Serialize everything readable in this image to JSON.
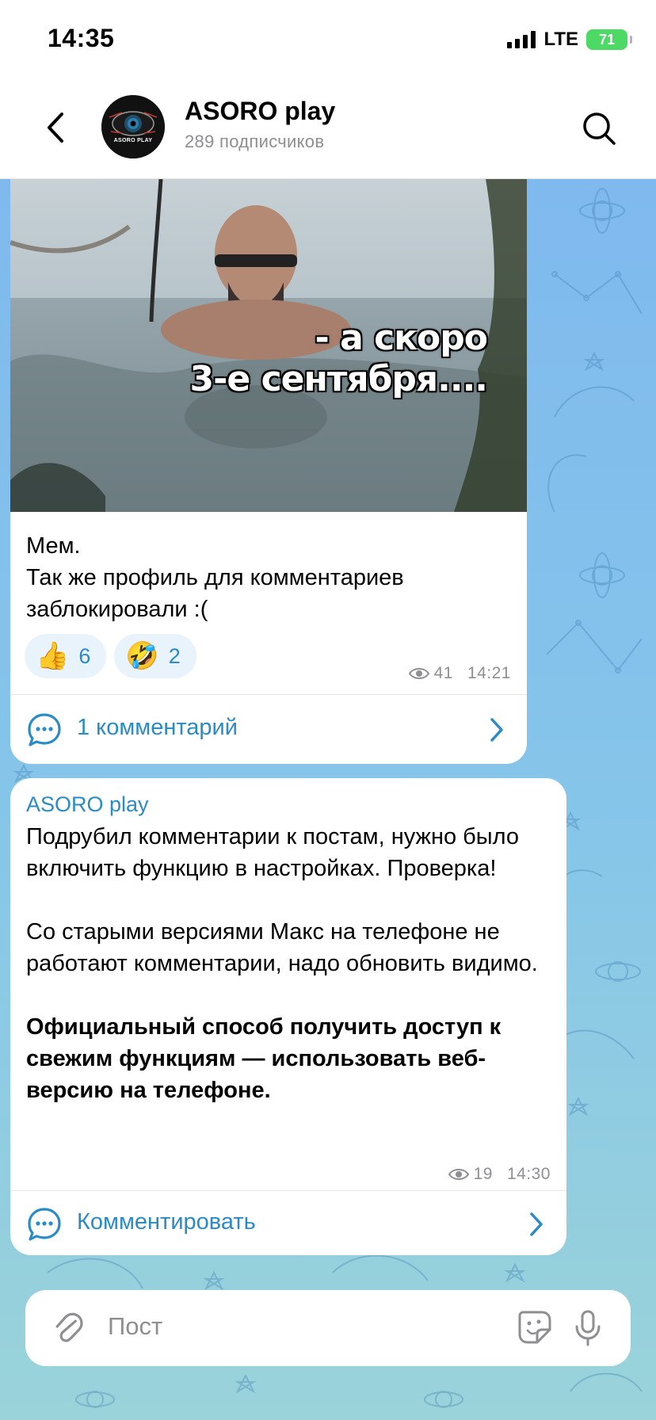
{
  "status_bar": {
    "time": "14:35",
    "network": "LTE",
    "battery": "71"
  },
  "header": {
    "title": "ASORO play",
    "subtitle": "289 подписчиков",
    "avatar_text": "ASORO PLAY"
  },
  "post1": {
    "meme_caption_line1": "- а скоро",
    "meme_caption_line2": "3-е сентября....",
    "text_line1": "Мем.",
    "text_line2": "Так же профиль для комментариев заблокировали :(",
    "reactions": [
      {
        "emoji": "👍",
        "count": "6"
      },
      {
        "emoji": "🤣",
        "count": "2"
      }
    ],
    "views": "41",
    "time": "14:21",
    "comments_label": "1 комментарий"
  },
  "post2": {
    "author": "ASORO play",
    "paragraph1": "Подрубил комментарии к постам, нужно было включить функцию в настройках. Проверка!",
    "paragraph2": "Со старыми версиями Макс на телефоне не работают комментарии, надо обновить видимо.",
    "paragraph3": "Официальный способ получить доступ к свежим функциям — использовать веб-версию на телефоне.",
    "views": "19",
    "time": "14:30",
    "comments_label": "Комментировать"
  },
  "composer": {
    "placeholder": "Пост"
  },
  "colors": {
    "accent": "#2a8bc7",
    "meta_gray": "#8e8e93",
    "battery_green": "#4cd964"
  },
  "icons": {
    "back": "chevron-left-icon",
    "search": "search-icon",
    "views": "eye-icon",
    "comments": "comment-bubble-icon",
    "forward": "chevron-right-icon",
    "attach": "paperclip-icon",
    "sticker": "sticker-icon",
    "mic": "microphone-icon"
  }
}
